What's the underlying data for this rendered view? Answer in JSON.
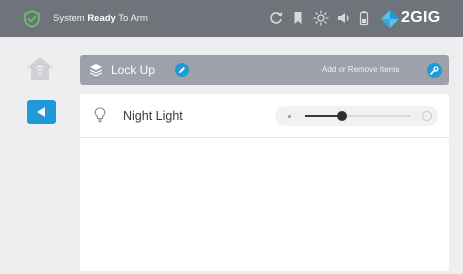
{
  "topbar": {
    "status_prefix": "System ",
    "status_bold": "Ready",
    "status_suffix": " To Arm",
    "logo_text": "2GIG",
    "icons": [
      "shield-check-icon",
      "refresh-icon",
      "bookmark-icon",
      "brightness-icon",
      "volume-icon",
      "battery-icon",
      "2gig-logo"
    ]
  },
  "sidebar": {
    "home_icon": "home-icon",
    "back_icon": "back-arrow-icon"
  },
  "scene": {
    "name": "Lock Up",
    "add_remove_label": "Add or Remove Items"
  },
  "devices": [
    {
      "name": "Night Light",
      "icon": "light-bulb-icon",
      "level_fraction": 0.35
    }
  ],
  "colors": {
    "accent": "#1f9ad8",
    "topbar": "#6f737a",
    "scene_bar": "#9da2aa",
    "shield": "#6abf69"
  }
}
